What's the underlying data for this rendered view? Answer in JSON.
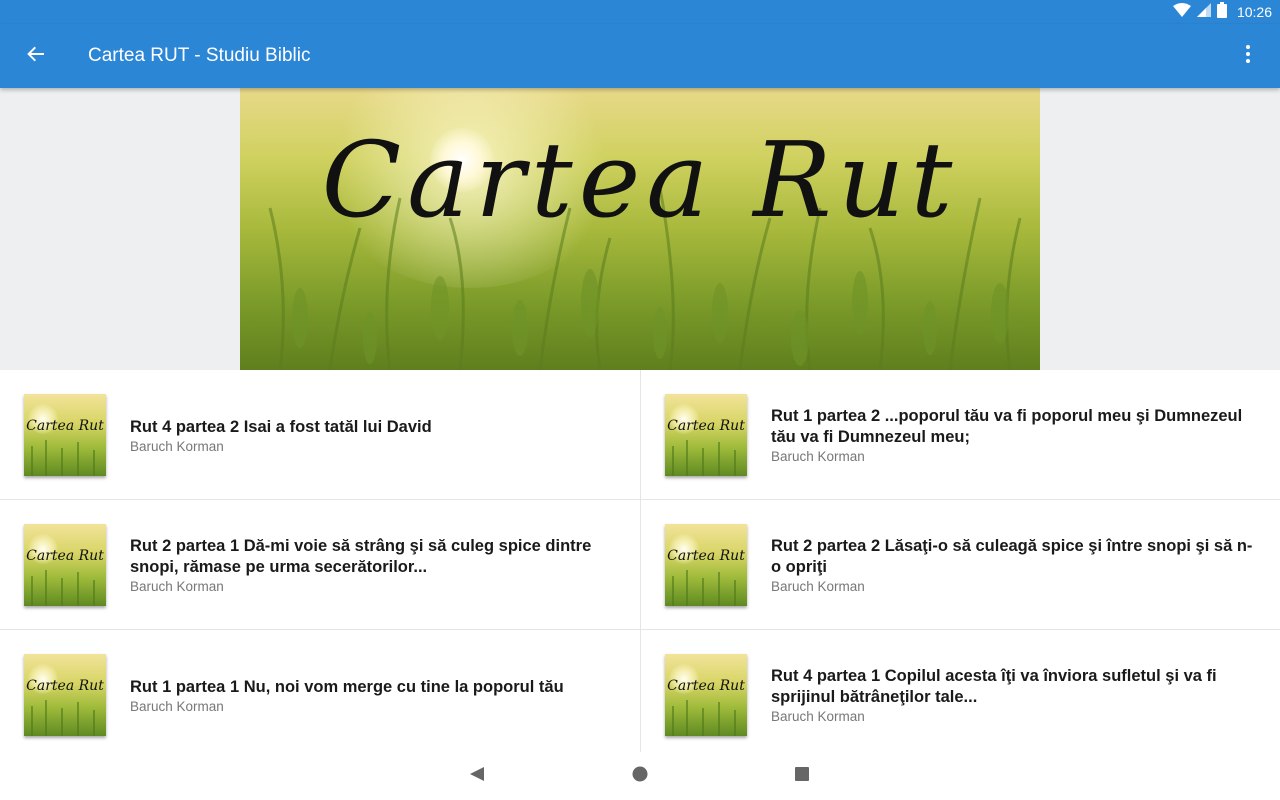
{
  "status": {
    "time": "10:26"
  },
  "appbar": {
    "title": "Cartea RUT - Studiu Biblic",
    "color": "#2c86d6"
  },
  "banner": {
    "text": "Cartea Rut"
  },
  "thumb_text": "Cartea Rut",
  "items": [
    {
      "title": "Rut 4 partea 2 Isai a fost tatăl lui David",
      "author": "Baruch Korman"
    },
    {
      "title": "Rut 1 partea 2 ...poporul tău va fi poporul meu şi Dumnezeul tău va fi Dumnezeul meu;",
      "author": "Baruch Korman"
    },
    {
      "title": "Rut 2 partea 1 Dă-mi voie să strâng şi să culeg spice dintre snopi, rămase pe urma secerătorilor...",
      "author": "Baruch Korman"
    },
    {
      "title": "Rut 2 partea 2 Lăsaţi-o să culeagă spice şi între snopi şi să n-o opriţi",
      "author": "Baruch Korman"
    },
    {
      "title": "Rut 1 partea 1 Nu, noi vom merge cu tine la poporul tău",
      "author": "Baruch Korman"
    },
    {
      "title": "Rut 4 partea 1 Copilul acesta îţi va înviora sufletul şi va fi sprijinul bătrâneţilor tale...",
      "author": "Baruch Korman"
    }
  ],
  "icons": {
    "back": "arrow-back-icon",
    "menu": "more-vert-icon",
    "wifi": "wifi-icon",
    "signal": "signal-icon",
    "battery": "battery-icon",
    "nav_back": "nav-back-icon",
    "nav_home": "nav-home-icon",
    "nav_recents": "nav-recents-icon"
  }
}
